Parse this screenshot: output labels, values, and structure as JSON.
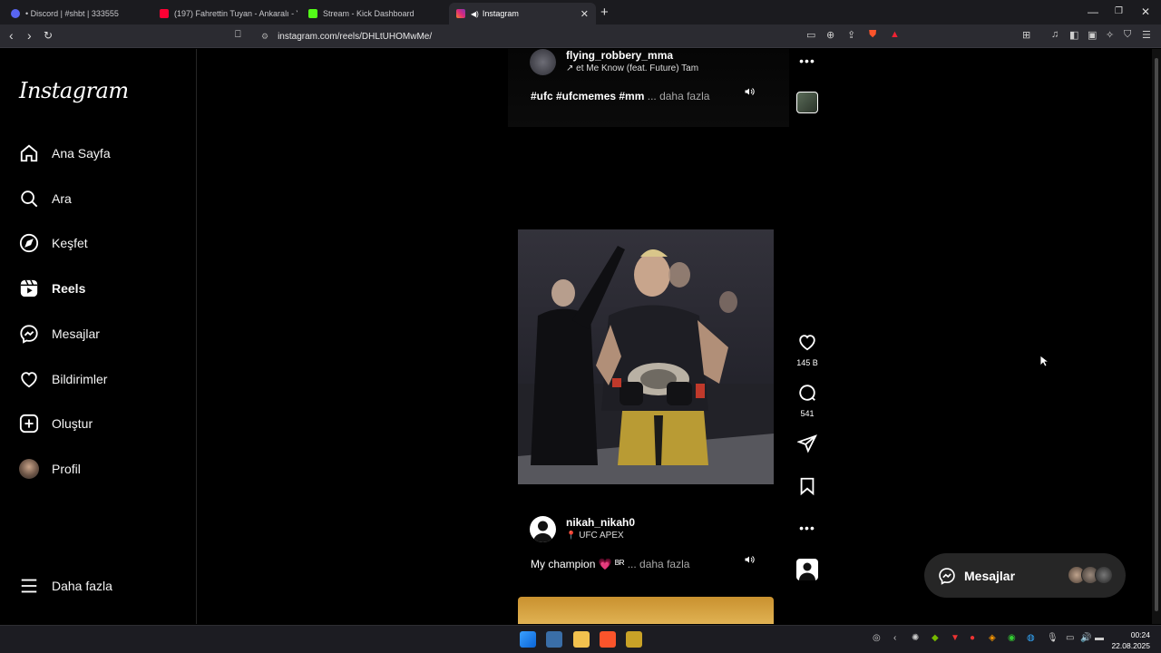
{
  "browser": {
    "tabs": [
      {
        "label": "• Discord | #shbt | 333555",
        "color": "#5865f2"
      },
      {
        "label": "(197) Fahrettin Tuyan - Ankaralı - You",
        "color": "#ff0033"
      },
      {
        "label": "Stream - Kick Dashboard",
        "color": "#53fc18"
      },
      {
        "label": "Instagram",
        "color": "#e1306c"
      }
    ],
    "url": "instagram.com/reels/DHLtUHOMwMe/"
  },
  "sidebar": {
    "logo": "Instagram",
    "items": [
      {
        "label": "Ana Sayfa",
        "icon": "home-icon"
      },
      {
        "label": "Ara",
        "icon": "search-icon"
      },
      {
        "label": "Keşfet",
        "icon": "compass-icon"
      },
      {
        "label": "Reels",
        "icon": "reels-icon"
      },
      {
        "label": "Mesajlar",
        "icon": "messenger-icon"
      },
      {
        "label": "Bildirimler",
        "icon": "heart-icon"
      },
      {
        "label": "Oluştur",
        "icon": "plus-icon"
      },
      {
        "label": "Profil",
        "icon": "avatar"
      }
    ],
    "more": "Daha fazla"
  },
  "reel1": {
    "username": "flying_robbery_mma",
    "audio": "↗ et Me Know (feat. Future)  Tam",
    "caption": "#ufc #ufcmemes #mm",
    "more": "... daha fazla"
  },
  "reel2": {
    "likes": "145 B",
    "comments": "541",
    "username": "nikah_nikah0",
    "location": "UFC APEX",
    "caption": "My champion 💗 ᴮᴿ",
    "more": "... daha fazla"
  },
  "messages": {
    "label": "Mesajlar"
  },
  "taskbar": {
    "time": "00:24",
    "date": "22.08.2025"
  },
  "colors": {
    "background": "#000000",
    "panel": "#262626",
    "muted": "#a8a8a8"
  }
}
